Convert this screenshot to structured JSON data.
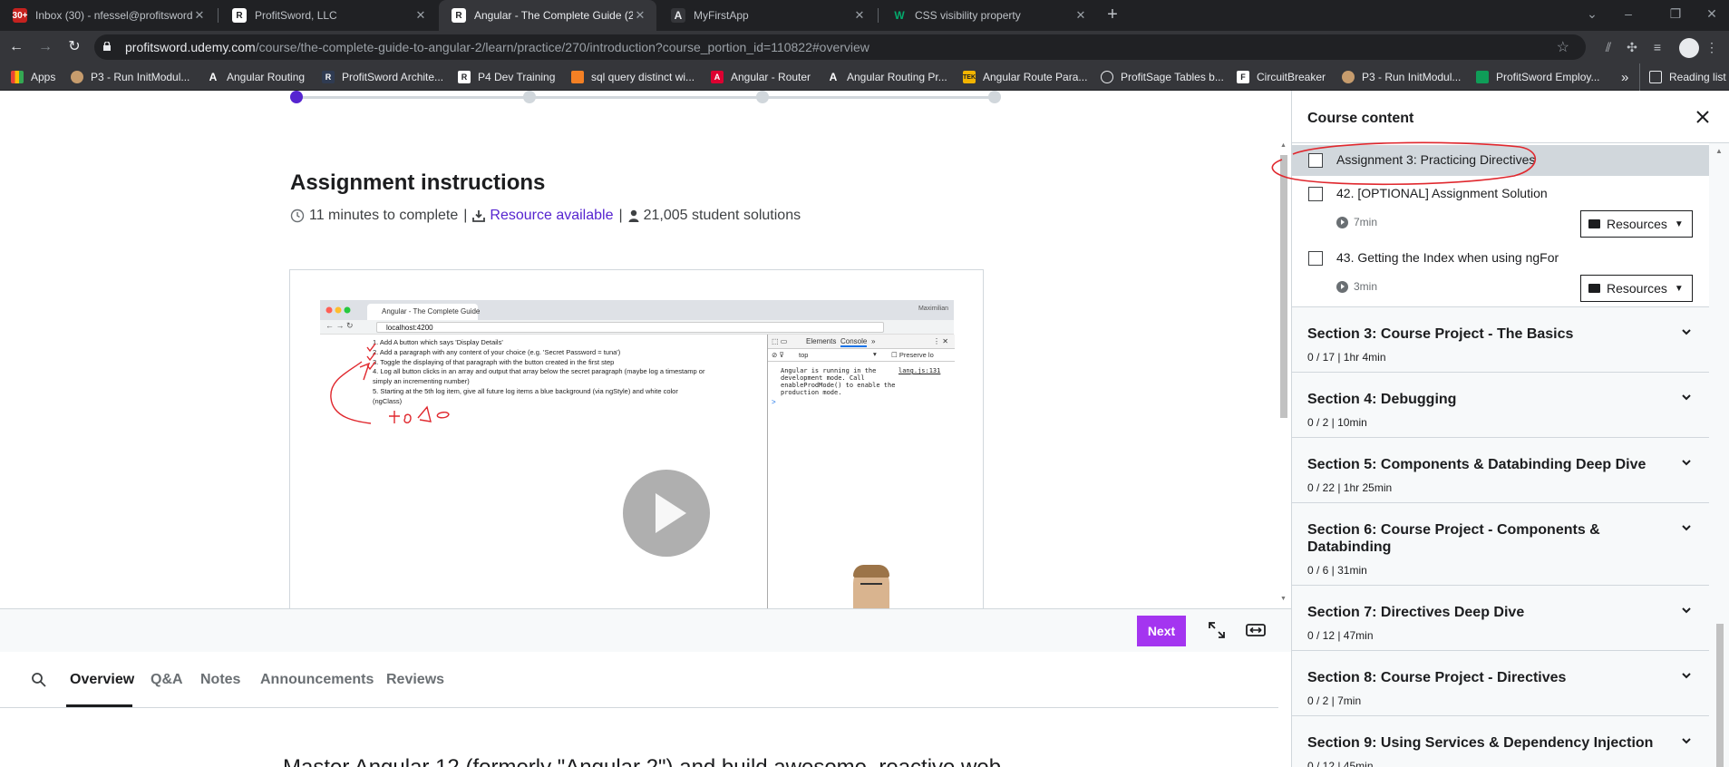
{
  "browser": {
    "tabs": [
      {
        "title": "Inbox (30) - nfessel@profitsword",
        "favicon": "gmail-icon",
        "color": "#c5221f",
        "badge": "30+"
      },
      {
        "title": "ProfitSword, LLC",
        "favicon": "profitsword-icon",
        "color": "#9aa0a6",
        "badge": "R"
      },
      {
        "title": "Angular - The Complete Guide (2",
        "favicon": "profitsword-icon",
        "color": "#9aa0a6",
        "badge": "R"
      },
      {
        "title": "MyFirstApp",
        "favicon": "angular-icon",
        "color": "#9aa0a6",
        "badge": "A"
      },
      {
        "title": "CSS visibility property",
        "favicon": "w3schools-icon",
        "color": "#04aa6d",
        "badge": "W"
      }
    ],
    "url_host": "profitsword.udemy.com",
    "url_path": "/course/the-complete-guide-to-angular-2/learn/practice/270/introduction?course_portion_id=110822#overview",
    "bookmarks": [
      {
        "label": "Apps",
        "icon": "apps-grid-icon"
      },
      {
        "label": "P3 - Run InitModul...",
        "icon": "bookmark-avatar-icon"
      },
      {
        "label": "Angular Routing",
        "icon": "angular-icon"
      },
      {
        "label": "ProfitSword Archite...",
        "icon": "confluence-icon"
      },
      {
        "label": "P4 Dev Training",
        "icon": "profitsword-icon"
      },
      {
        "label": "sql query distinct wi...",
        "icon": "stackoverflow-icon"
      },
      {
        "label": "Angular - Router",
        "icon": "angular-red-icon"
      },
      {
        "label": "Angular Routing Pr...",
        "icon": "angular-icon"
      },
      {
        "label": "Angular Route Para...",
        "icon": "tek-icon"
      },
      {
        "label": "ProfitSage Tables b...",
        "icon": "globe-icon"
      },
      {
        "label": "CircuitBreaker",
        "icon": "f-icon"
      },
      {
        "label": "P3 - Run InitModul...",
        "icon": "bookmark-avatar-icon"
      },
      {
        "label": "ProfitSword Employ...",
        "icon": "sheets-icon"
      }
    ],
    "more_label": "»",
    "reading_list": "Reading list"
  },
  "main": {
    "title": "Assignment instructions",
    "minutes": "11 minutes to complete",
    "resource": "Resource available",
    "solutions": "21,005 student solutions",
    "separator": "|",
    "video": {
      "tab_title": "Angular - The Complete Guide",
      "user": "Maximilian",
      "url": "localhost:4200",
      "tasks": [
        "1. Add A button which says 'Display Details'",
        "2. Add a paragraph with any content of your choice (e.g. 'Secret Password = tuna')",
        "3. Toggle the displaying of that paragraph with the button created in the first step",
        "4. Log all button clicks in an array and output that array below the secret paragraph (maybe log a timestamp or",
        "    simply an incrementing number)",
        "5. Starting at the 5th log item, give all future log items a blue background (via ngStyle) and white color",
        "    (ngClass)"
      ],
      "handwriting": "todo",
      "devtools_tabs": [
        "Elements",
        "Console",
        "»"
      ],
      "console_context": "top",
      "preserve_log": "Preserve lo",
      "console_text": "Angular is running in the\ndevelopment mode. Call\nenableProdMode() to enable the\nproduction mode.",
      "console_source": "lang.js:131",
      "console_prompt": ">"
    },
    "next_label": "Next",
    "tabs": [
      "Overview",
      "Q&A",
      "Notes",
      "Announcements",
      "Reviews"
    ],
    "description": "Master Angular 12 (formerly \"Angular 2\") and build awesome, reactive web"
  },
  "sidebar": {
    "title": "Course content",
    "lectures": [
      {
        "title": "Assignment 3: Practicing Directives",
        "duration": "",
        "resources": ""
      },
      {
        "title": "42. [OPTIONAL] Assignment Solution",
        "duration": "7min",
        "resources": "Resources"
      },
      {
        "title": "43. Getting the Index when using ngFor",
        "duration": "3min",
        "resources": "Resources"
      }
    ],
    "sections": [
      {
        "title": "Section 3: Course Project - The Basics",
        "meta": "0 / 17 | 1hr 4min"
      },
      {
        "title": "Section 4: Debugging",
        "meta": "0 / 2 | 10min"
      },
      {
        "title": "Section 5: Components & Databinding Deep Dive",
        "meta": "0 / 22 | 1hr 25min"
      },
      {
        "title": "Section 6: Course Project - Components & Databinding",
        "meta": "0 / 6 | 31min"
      },
      {
        "title": "Section 7: Directives Deep Dive",
        "meta": "0 / 12 | 47min"
      },
      {
        "title": "Section 8: Course Project - Directives",
        "meta": "0 / 2 | 7min"
      },
      {
        "title": "Section 9: Using Services & Dependency Injection",
        "meta": "0 / 12 | 45min"
      }
    ]
  },
  "colors": {
    "accent": "#a435f0",
    "link": "#5624d0",
    "highlight_row": "#d1d7dc",
    "annotation_red": "#e0282e"
  }
}
